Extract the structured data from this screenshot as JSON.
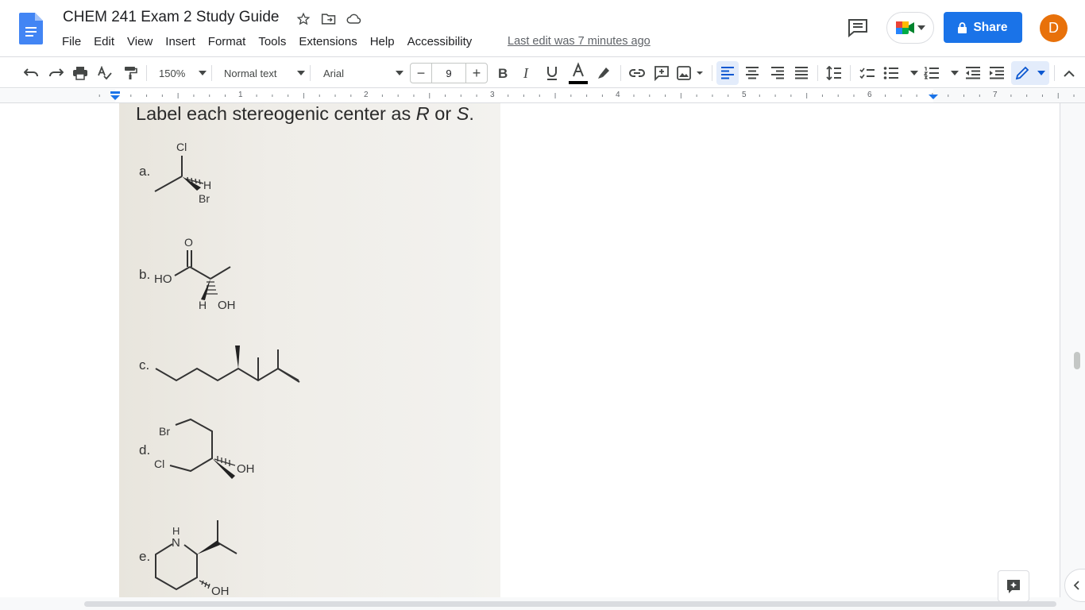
{
  "document": {
    "title": "CHEM 241 Exam 2 Study Guide",
    "last_edit": "Last edit was 7 minutes ago"
  },
  "menu": [
    "File",
    "Edit",
    "View",
    "Insert",
    "Format",
    "Tools",
    "Extensions",
    "Help",
    "Accessibility"
  ],
  "share": {
    "label": "Share"
  },
  "avatar": {
    "initial": "D",
    "color": "#e8710a"
  },
  "toolbar": {
    "zoom": "150%",
    "style": "Normal text",
    "font": "Arial",
    "font_size": "9",
    "minus": "−",
    "plus": "+"
  },
  "ruler": {
    "numbers": [
      "1",
      "2",
      "3",
      "4",
      "5",
      "6",
      "7"
    ]
  },
  "content": {
    "question_start": "Label each stereogenic center as ",
    "r": "R",
    "or": " or ",
    "s": "S",
    "period": ".",
    "items": [
      {
        "letter": "a.",
        "atoms": [
          "Cl",
          "H",
          "Br"
        ]
      },
      {
        "letter": "b.",
        "atoms": [
          "O",
          "HO",
          "H",
          "OH"
        ]
      },
      {
        "letter": "c.",
        "atoms": []
      },
      {
        "letter": "d.",
        "atoms": [
          "Br",
          "Cl",
          "OH"
        ]
      },
      {
        "letter": "e.",
        "atoms": [
          "H",
          "N",
          "OH"
        ]
      }
    ]
  },
  "colors": {
    "accent": "#1a73e8",
    "docs_blue": "#4285f4"
  }
}
